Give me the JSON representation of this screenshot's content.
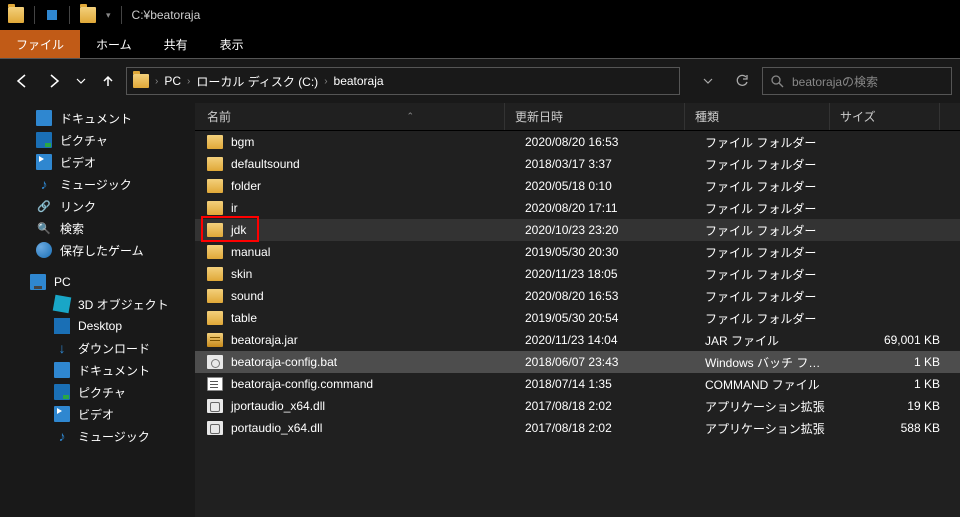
{
  "title_path": "C:¥beatoraja",
  "ribbon": {
    "file": "ファイル",
    "home": "ホーム",
    "share": "共有",
    "view": "表示"
  },
  "breadcrumbs": [
    "PC",
    "ローカル ディスク (C:)",
    "beatoraja"
  ],
  "search_placeholder": "beatorajaの検索",
  "columns": {
    "name": "名前",
    "date": "更新日時",
    "type": "種類",
    "size": "サイズ"
  },
  "sidebar": {
    "quick": [
      {
        "label": "ドキュメント",
        "icon": "docs"
      },
      {
        "label": "ピクチャ",
        "icon": "pics"
      },
      {
        "label": "ビデオ",
        "icon": "video"
      },
      {
        "label": "ミュージック",
        "icon": "music"
      },
      {
        "label": "リンク",
        "icon": "link"
      },
      {
        "label": "検索",
        "icon": "search"
      },
      {
        "label": "保存したゲーム",
        "icon": "game"
      }
    ],
    "pc_label": "PC",
    "pc": [
      {
        "label": "3D オブジェクト",
        "icon": "3d"
      },
      {
        "label": "Desktop",
        "icon": "desktop"
      },
      {
        "label": "ダウンロード",
        "icon": "dl"
      },
      {
        "label": "ドキュメント",
        "icon": "docs"
      },
      {
        "label": "ピクチャ",
        "icon": "pics"
      },
      {
        "label": "ビデオ",
        "icon": "video"
      },
      {
        "label": "ミュージック",
        "icon": "music"
      }
    ]
  },
  "files": [
    {
      "name": "bgm",
      "date": "2020/08/20 16:53",
      "type": "ファイル フォルダー",
      "size": "",
      "icon": "folder"
    },
    {
      "name": "defaultsound",
      "date": "2018/03/17 3:37",
      "type": "ファイル フォルダー",
      "size": "",
      "icon": "folder"
    },
    {
      "name": "folder",
      "date": "2020/05/18 0:10",
      "type": "ファイル フォルダー",
      "size": "",
      "icon": "folder"
    },
    {
      "name": "ir",
      "date": "2020/08/20 17:11",
      "type": "ファイル フォルダー",
      "size": "",
      "icon": "folder"
    },
    {
      "name": "jdk",
      "date": "2020/10/23 23:20",
      "type": "ファイル フォルダー",
      "size": "",
      "icon": "folder",
      "highlighted": true,
      "boxed": true
    },
    {
      "name": "manual",
      "date": "2019/05/30 20:30",
      "type": "ファイル フォルダー",
      "size": "",
      "icon": "folder"
    },
    {
      "name": "skin",
      "date": "2020/11/23 18:05",
      "type": "ファイル フォルダー",
      "size": "",
      "icon": "folder"
    },
    {
      "name": "sound",
      "date": "2020/08/20 16:53",
      "type": "ファイル フォルダー",
      "size": "",
      "icon": "folder"
    },
    {
      "name": "table",
      "date": "2019/05/30 20:54",
      "type": "ファイル フォルダー",
      "size": "",
      "icon": "folder"
    },
    {
      "name": "beatoraja.jar",
      "date": "2020/11/23 14:04",
      "type": "JAR ファイル",
      "size": "69,001 KB",
      "icon": "jar"
    },
    {
      "name": "beatoraja-config.bat",
      "date": "2018/06/07 23:43",
      "type": "Windows バッチ ファ...",
      "size": "1 KB",
      "icon": "bat",
      "selected": true
    },
    {
      "name": "beatoraja-config.command",
      "date": "2018/07/14 1:35",
      "type": "COMMAND ファイル",
      "size": "1 KB",
      "icon": "cmd"
    },
    {
      "name": "jportaudio_x64.dll",
      "date": "2017/08/18 2:02",
      "type": "アプリケーション拡張",
      "size": "19 KB",
      "icon": "dll"
    },
    {
      "name": "portaudio_x64.dll",
      "date": "2017/08/18 2:02",
      "type": "アプリケーション拡張",
      "size": "588 KB",
      "icon": "dll"
    }
  ]
}
